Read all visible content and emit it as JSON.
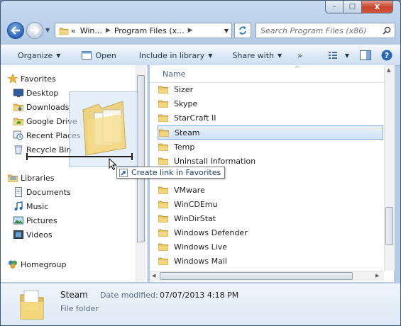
{
  "window": {
    "minimize": "–",
    "maximize": "□",
    "close": "x"
  },
  "address": {
    "overflow": "«",
    "crumbs": [
      "Win...",
      "Program Files (x..."
    ],
    "separator": "▶",
    "search_placeholder": "Search Program Files (x86)"
  },
  "toolbar": {
    "organize": "Organize",
    "open": "Open",
    "include": "Include in library",
    "share": "Share with",
    "more": "»"
  },
  "nav": {
    "favorites": {
      "title": "Favorites",
      "items": [
        "Desktop",
        "Downloads",
        "Google Drive",
        "Recent Places",
        "Recycle Bin"
      ]
    },
    "libraries": {
      "title": "Libraries",
      "items": [
        "Documents",
        "Music",
        "Pictures",
        "Videos"
      ]
    },
    "homegroup": "Homegroup"
  },
  "filelist": {
    "column_name": "Name",
    "items": [
      {
        "name": "Sizer"
      },
      {
        "name": "Skype"
      },
      {
        "name": "StarCraft II"
      },
      {
        "name": "Steam",
        "selected": true
      },
      {
        "name": "Temp"
      },
      {
        "name": "Uninstall Information"
      },
      {
        "name": "VMware"
      },
      {
        "name": "WinCDEmu"
      },
      {
        "name": "WinDirStat"
      },
      {
        "name": "Windows Defender"
      },
      {
        "name": "Windows Live"
      },
      {
        "name": "Windows Mail"
      }
    ]
  },
  "tooltip": "Create link in Favorites",
  "details": {
    "name": "Steam",
    "modified_label": "Date modified:",
    "modified_value": "07/07/2013 4:18 PM",
    "type": "File folder"
  },
  "colors": {
    "folder": "#e8c15a",
    "selection": "#cfe2f7",
    "accent": "#1b3a69"
  }
}
